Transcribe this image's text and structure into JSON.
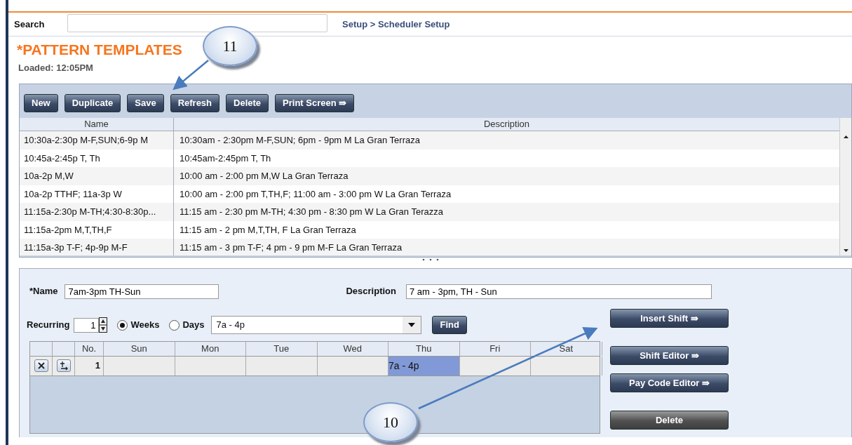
{
  "search": {
    "label": "Search"
  },
  "breadcrumb": "Setup > Scheduler Setup",
  "title": "*PATTERN TEMPLATES",
  "loaded": "Loaded: 12:05PM",
  "toolbar": [
    {
      "label": "New"
    },
    {
      "label": "Duplicate"
    },
    {
      "label": "Save"
    },
    {
      "label": "Refresh"
    },
    {
      "label": "Delete"
    },
    {
      "label": "Print Screen ⇛"
    }
  ],
  "templates": {
    "columns": [
      "Name",
      "Description"
    ],
    "rows": [
      {
        "name": "10:30a-2:30p M-F,SUN;6-9p M",
        "description": "10:30am - 2:30pm M-F,SUN; 6pm - 9pm M La Gran Terraza"
      },
      {
        "name": "10:45a-2:45p T, Th",
        "description": "10:45am-2:45pm T, Th"
      },
      {
        "name": "10a-2p M,W",
        "description": "10:00 am - 2:00 pm M,W La Gran Terraza"
      },
      {
        "name": "10a-2p TTHF; 11a-3p W",
        "description": "10:00 am - 2:00 pm T,TH,F; 11:00 am - 3:00 pm W La Gran Terraza"
      },
      {
        "name": "11:15a-2:30p M-TH;4:30-8:30p...",
        "description": "11:15 am - 2:30 pm M-TH; 4:30 pm - 8:30 pm W La Gran Terazza"
      },
      {
        "name": "11:15a-2pm M,T,TH,F",
        "description": "11:15 am - 2 pm M,T,TH, F La Gran Terraza"
      },
      {
        "name": "11:15a-3p T-F; 4p-9p M-F",
        "description": "11:15 am - 3 pm T-F; 4 pm - 9 pm M-F La Gran Terraza"
      }
    ]
  },
  "form": {
    "name_label": "*Name",
    "name_value": "7am-3pm TH-Sun",
    "description_label": "Description",
    "description_value": "7 am - 3pm, TH - Sun",
    "recurring_label": "Recurring",
    "recurring_value": "1",
    "radios": [
      {
        "label": "Weeks",
        "selected": true
      },
      {
        "label": "Days",
        "selected": false
      }
    ],
    "shift_value": "7a - 4p",
    "find": "Find"
  },
  "grid": {
    "columns": [
      "No.",
      "Sun",
      "Mon",
      "Tue",
      "Wed",
      "Thu",
      "Fri",
      "Sat"
    ],
    "rows": [
      {
        "no": "1",
        "cells": [
          {
            "selected": false
          },
          {
            "selected": false
          },
          {
            "selected": false
          },
          {
            "selected": false
          },
          {
            "text": "7a - 4p",
            "selected": true
          },
          {
            "selected": false
          },
          {
            "selected": false
          }
        ]
      }
    ]
  },
  "side_buttons": [
    {
      "label": "Insert Shift ⇛",
      "kind": "blue"
    },
    {
      "label": "Shift Editor ⇛",
      "kind": "blue"
    },
    {
      "label": "Pay Code Editor ⇛",
      "kind": "blue"
    },
    {
      "label": "Delete",
      "kind": "dark"
    }
  ],
  "callouts": [
    {
      "label": "11"
    },
    {
      "label": "10"
    }
  ]
}
